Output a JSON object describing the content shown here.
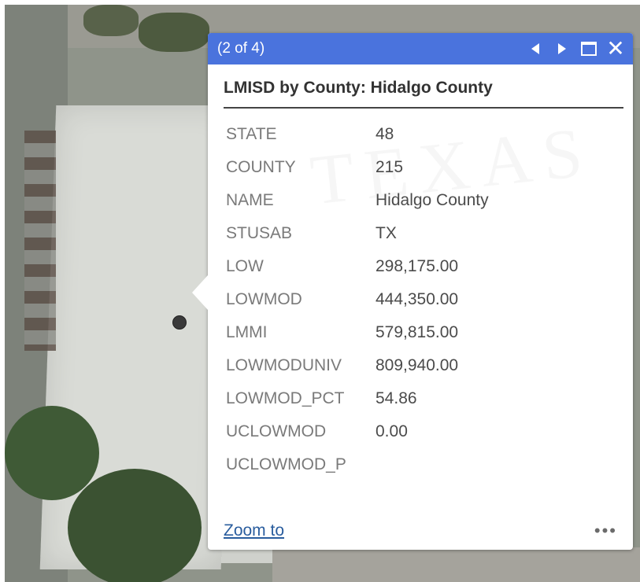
{
  "popup": {
    "counter": "(2 of 4)",
    "title": "LMISD by County: Hidalgo County",
    "attributes": [
      {
        "key": "STATE",
        "value": "48"
      },
      {
        "key": "COUNTY",
        "value": "215"
      },
      {
        "key": "NAME",
        "value": "Hidalgo County"
      },
      {
        "key": "STUSAB",
        "value": "TX"
      },
      {
        "key": "LOW",
        "value": "298,175.00"
      },
      {
        "key": "LOWMOD",
        "value": "444,350.00"
      },
      {
        "key": "LMMI",
        "value": "579,815.00"
      },
      {
        "key": "LOWMODUNIV",
        "value": "809,940.00"
      },
      {
        "key": "LOWMOD_PCT",
        "value": "54.86"
      },
      {
        "key": "UCLOWMOD",
        "value": "0.00"
      },
      {
        "key": "UCLOWMOD_P",
        "value": ""
      }
    ],
    "zoom_label": "Zoom to",
    "more_label": "•••",
    "close_glyph": "✕",
    "watermark": "TEXAS",
    "icons": [
      "previous-icon",
      "next-icon",
      "maximize-icon",
      "close-icon",
      "more-options-icon"
    ]
  },
  "colors": {
    "header": "#4a73dd",
    "link": "#2a5d9e"
  }
}
